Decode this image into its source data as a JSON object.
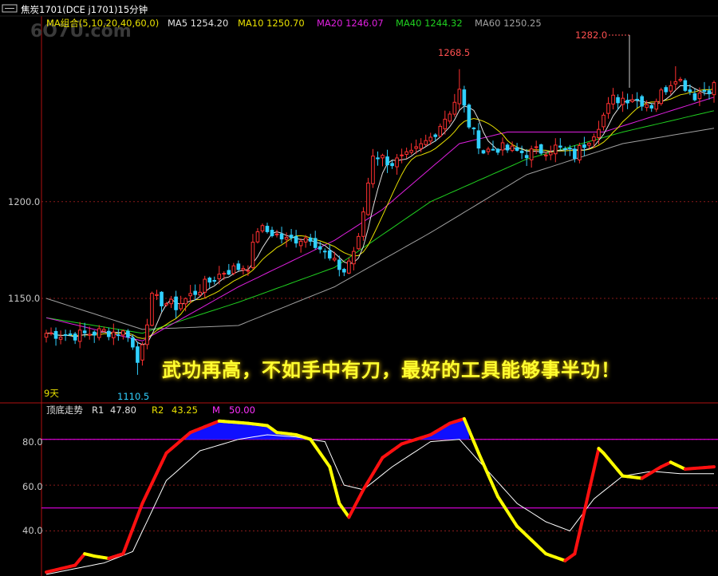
{
  "title": {
    "text": "焦炭1701(DCE j1701)15分钟",
    "watermark": "6Ö7Ü.cöm"
  },
  "ma_header": {
    "label": "MA组合(5,10,20,40,60,0)",
    "items": [
      {
        "text": "MA5 1254.20",
        "color": "#e0e0e0"
      },
      {
        "text": "MA10 1250.70",
        "color": "#e8e000"
      },
      {
        "text": "MA20 1246.07",
        "color": "#e020e0"
      },
      {
        "text": "MA40 1244.32",
        "color": "#20d020"
      },
      {
        "text": "MA60 1250.25",
        "color": "#a0a0a0"
      }
    ]
  },
  "annotations": {
    "high1": "1268.5",
    "high2": "1282.0",
    "low": "1110.5",
    "days": "9天",
    "slogan": "武功再高，不如手中有刀，最好的工具能够事半功！"
  },
  "indicator_header": {
    "name": "顶底走势",
    "r1_label": "R1",
    "r1_value": "47.80",
    "r2_label": "R2",
    "r2_value": "43.25",
    "m_label": "M",
    "m_value": "50.00"
  },
  "colors": {
    "up_candle": "#ff3030",
    "down_candle": "#30d0ff",
    "grid": "#8a1a1a",
    "axis": "#b01010",
    "axis_text": "#c8c8c8",
    "ma5": "#e0e0e0",
    "ma10": "#e8e000",
    "ma20": "#e020e0",
    "ma40": "#20d020",
    "ma60": "#a0a0a0",
    "fill_top": "#1010ff",
    "slogan": "#ffff30",
    "osc_rise": "#ff1010",
    "osc_fall": "#ffff00",
    "magenta": "#ff00ff"
  },
  "chart_data": [
    {
      "type": "candlestick",
      "title": "焦炭1701(DCE j1701)15分钟",
      "y_ticks": [
        "1200.0",
        "1150.0"
      ],
      "y_tick_values": [
        1200,
        1150
      ],
      "ylim": [
        1096,
        1296
      ],
      "num_bars": 140,
      "anchors": [
        {
          "bar": 0,
          "close": 1132
        },
        {
          "bar": 6,
          "close": 1131
        },
        {
          "bar": 12,
          "close": 1133
        },
        {
          "bar": 17,
          "close": 1132
        },
        {
          "bar": 19,
          "close": 1117
        },
        {
          "bar": 22,
          "close": 1150
        },
        {
          "bar": 27,
          "close": 1146
        },
        {
          "bar": 33,
          "close": 1157
        },
        {
          "bar": 37,
          "close": 1164
        },
        {
          "bar": 42,
          "close": 1167
        },
        {
          "bar": 44,
          "close": 1186
        },
        {
          "bar": 47,
          "close": 1184
        },
        {
          "bar": 50,
          "close": 1180
        },
        {
          "bar": 55,
          "close": 1182
        },
        {
          "bar": 59,
          "close": 1170
        },
        {
          "bar": 62,
          "close": 1164
        },
        {
          "bar": 65,
          "close": 1180
        },
        {
          "bar": 68,
          "close": 1225
        },
        {
          "bar": 72,
          "close": 1220
        },
        {
          "bar": 76,
          "close": 1224
        },
        {
          "bar": 80,
          "close": 1233
        },
        {
          "bar": 84,
          "close": 1247
        },
        {
          "bar": 86,
          "close": 1257
        },
        {
          "bar": 88,
          "close": 1240
        },
        {
          "bar": 91,
          "close": 1226
        },
        {
          "bar": 94,
          "close": 1228
        },
        {
          "bar": 100,
          "close": 1225
        },
        {
          "bar": 106,
          "close": 1228
        },
        {
          "bar": 110,
          "close": 1224
        },
        {
          "bar": 114,
          "close": 1236
        },
        {
          "bar": 118,
          "close": 1253
        },
        {
          "bar": 122,
          "close": 1254
        },
        {
          "bar": 126,
          "close": 1250
        },
        {
          "bar": 131,
          "close": 1265
        },
        {
          "bar": 135,
          "close": 1255
        },
        {
          "bar": 139,
          "close": 1260
        }
      ],
      "ma_levels": {
        "ma20": [
          [
            0,
            1140
          ],
          [
            20,
            1128
          ],
          [
            40,
            1156
          ],
          [
            60,
            1180
          ],
          [
            70,
            1196
          ],
          [
            86,
            1230
          ],
          [
            96,
            1236
          ],
          [
            116,
            1236
          ],
          [
            139,
            1254
          ]
        ],
        "ma40": [
          [
            0,
            1140
          ],
          [
            20,
            1132
          ],
          [
            40,
            1148
          ],
          [
            60,
            1166
          ],
          [
            80,
            1200
          ],
          [
            100,
            1222
          ],
          [
            120,
            1236
          ],
          [
            139,
            1247
          ]
        ],
        "ma60": [
          [
            0,
            1150
          ],
          [
            20,
            1134
          ],
          [
            40,
            1136
          ],
          [
            60,
            1156
          ],
          [
            80,
            1184
          ],
          [
            100,
            1214
          ],
          [
            120,
            1230
          ],
          [
            139,
            1238
          ]
        ]
      }
    },
    {
      "type": "line",
      "title": "顶底走势",
      "series": [
        {
          "name": "R1",
          "last": 47.8
        },
        {
          "name": "R2",
          "last": 43.25
        },
        {
          "name": "M",
          "value": 50.0
        }
      ],
      "y_ticks": [
        "80.0",
        "60.0",
        "40.0"
      ],
      "y_tick_values": [
        80,
        60,
        40
      ],
      "hlines": [
        80,
        50
      ],
      "ylim": [
        21,
        90
      ],
      "r1_anchors": [
        [
          0,
          22
        ],
        [
          6,
          25
        ],
        [
          8,
          30
        ],
        [
          10,
          29
        ],
        [
          13,
          28
        ],
        [
          16,
          30
        ],
        [
          20,
          52
        ],
        [
          25,
          74
        ],
        [
          30,
          83
        ],
        [
          36,
          88
        ],
        [
          42,
          87
        ],
        [
          46,
          86
        ],
        [
          48,
          83
        ],
        [
          52,
          82
        ],
        [
          55,
          80
        ],
        [
          59,
          68
        ],
        [
          61,
          52
        ],
        [
          63,
          46
        ],
        [
          66,
          58
        ],
        [
          70,
          72
        ],
        [
          74,
          78
        ],
        [
          80,
          82
        ],
        [
          84,
          87
        ],
        [
          87,
          89
        ],
        [
          90,
          74
        ],
        [
          94,
          55
        ],
        [
          98,
          42
        ],
        [
          104,
          30
        ],
        [
          108,
          27
        ],
        [
          110,
          30
        ],
        [
          115,
          76
        ],
        [
          116,
          74
        ],
        [
          120,
          64
        ],
        [
          124,
          63
        ],
        [
          128,
          68
        ],
        [
          130,
          70
        ],
        [
          133,
          67
        ],
        [
          139,
          68
        ]
      ],
      "r2_anchors": [
        [
          0,
          21
        ],
        [
          12,
          26
        ],
        [
          18,
          31
        ],
        [
          25,
          62
        ],
        [
          32,
          75
        ],
        [
          40,
          80
        ],
        [
          46,
          82
        ],
        [
          52,
          81
        ],
        [
          58,
          79
        ],
        [
          62,
          60
        ],
        [
          66,
          58
        ],
        [
          72,
          68
        ],
        [
          80,
          79
        ],
        [
          86,
          80
        ],
        [
          92,
          66
        ],
        [
          98,
          52
        ],
        [
          104,
          44
        ],
        [
          109,
          40
        ],
        [
          114,
          54
        ],
        [
          120,
          64
        ],
        [
          126,
          66
        ],
        [
          132,
          65
        ],
        [
          139,
          65
        ]
      ]
    }
  ]
}
